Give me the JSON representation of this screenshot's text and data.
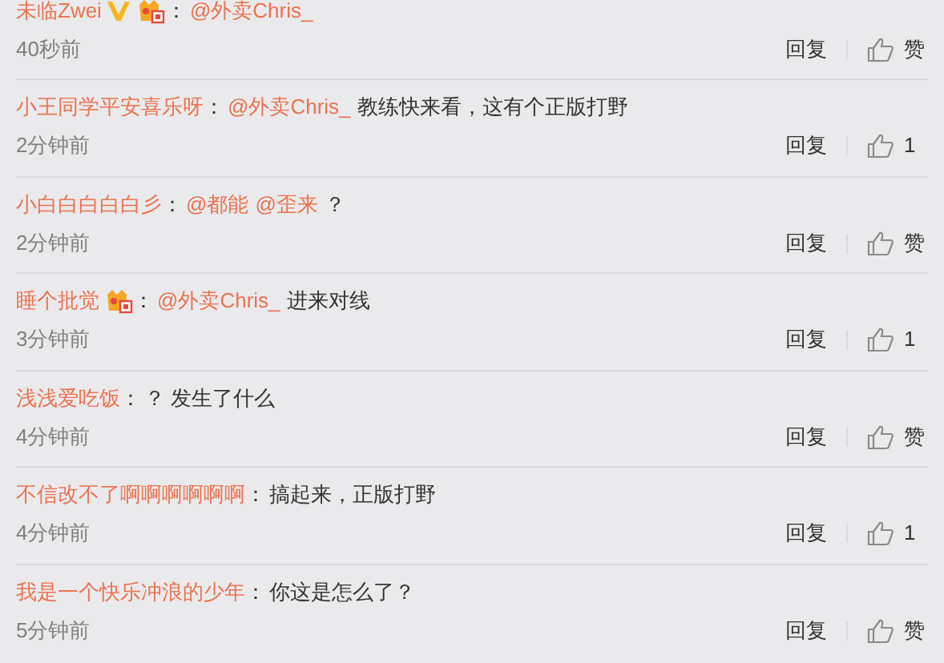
{
  "comments": [
    {
      "user": "未临Zwei",
      "badges": [
        {
          "kind": "verified"
        },
        {
          "kind": "medal"
        }
      ],
      "separator": "：",
      "body": [
        {
          "kind": "mention",
          "text": "@外卖Chris_"
        }
      ],
      "time": "40秒前",
      "reply": "回复",
      "likes": "赞"
    },
    {
      "user": "小王同学平安喜乐呀",
      "separator": "：",
      "body": [
        {
          "kind": "mention",
          "text": "@外卖Chris_"
        },
        {
          "kind": "text",
          "text": "教练快来看，这有个正版打野"
        }
      ],
      "time": "2分钟前",
      "reply": "回复",
      "likes": "1"
    },
    {
      "user": "小白白白白白彡",
      "separator": "：",
      "body": [
        {
          "kind": "mention",
          "text": "@都能"
        },
        {
          "kind": "mention",
          "text": "@歪来"
        },
        {
          "kind": "text",
          "text": "？"
        }
      ],
      "time": "2分钟前",
      "reply": "回复",
      "likes": "赞"
    },
    {
      "user": "睡个批觉",
      "badges": [
        {
          "kind": "medal"
        }
      ],
      "separator": "：",
      "body": [
        {
          "kind": "mention",
          "text": "@外卖Chris_"
        },
        {
          "kind": "text",
          "text": "进来对线"
        }
      ],
      "time": "3分钟前",
      "reply": "回复",
      "likes": "1"
    },
    {
      "user": "浅浅爱吃饭",
      "separator": "：",
      "body": [
        {
          "kind": "text",
          "text": "？ 发生了什么"
        }
      ],
      "time": "4分钟前",
      "reply": "回复",
      "likes": "赞"
    },
    {
      "user": "不信改不了啊啊啊啊啊啊",
      "separator": "：",
      "body": [
        {
          "kind": "text",
          "text": "搞起来，正版打野"
        }
      ],
      "time": "4分钟前",
      "reply": "回复",
      "likes": "1"
    },
    {
      "user": "我是一个快乐冲浪的少年",
      "separator": "：",
      "body": [
        {
          "kind": "text",
          "text": "你这是怎么了？"
        }
      ],
      "time": "5分钟前",
      "reply": "回复",
      "likes": "赞"
    }
  ]
}
